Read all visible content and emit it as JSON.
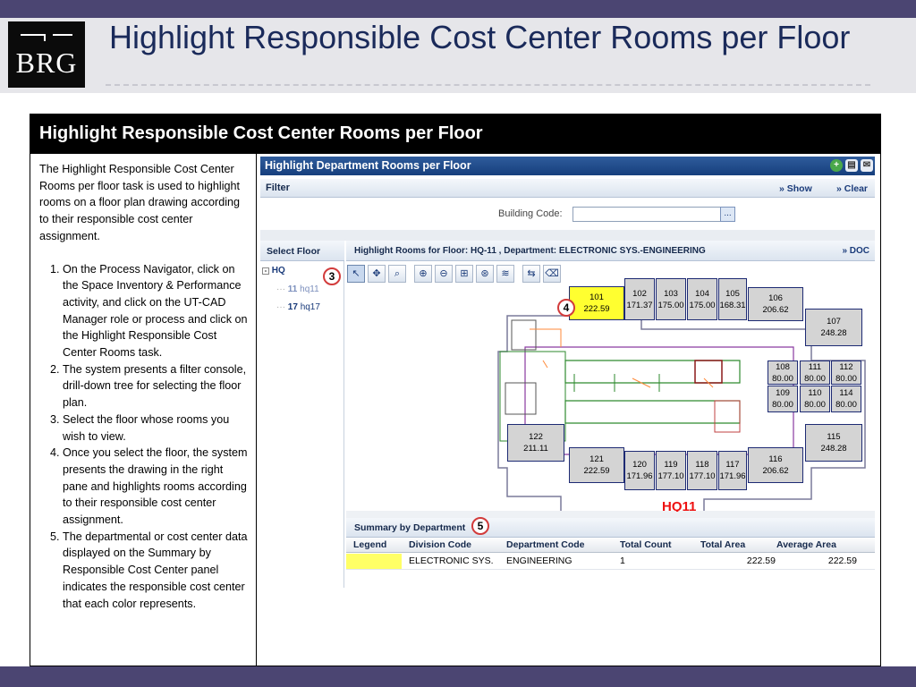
{
  "slide": {
    "title": "Highlight Responsible Cost Center Rooms per Floor",
    "logo_text": "BRG",
    "panel_heading": "Highlight Responsible Cost Center Rooms per Floor"
  },
  "description": {
    "intro": "The Highlight Responsible Cost Center Rooms per floor task is used to highlight rooms  on a floor plan drawing according to their responsible cost center assignment.",
    "steps": [
      "On the Process Navigator, click on the Space Inventory & Performance activity, and click on the UT-CAD Manager role or process and click on the Highlight Responsible Cost Center Rooms task.",
      "The system presents a filter console, drill-down tree for selecting the floor plan.",
      "Select the floor whose rooms you wish to view.",
      "Once you select the floor, the system presents the drawing in the right pane and highlights rooms according to their responsible cost center assignment.",
      "The departmental or cost center data displayed on the Summary by Responsible Cost Center panel indicates the responsible cost center that each color represents."
    ]
  },
  "app": {
    "title": "Highlight Department Rooms per Floor",
    "filter": {
      "label": "Filter",
      "show": "» Show",
      "clear": "» Clear",
      "building_code_label": "Building Code:",
      "building_code_value": "",
      "lookup": "..."
    },
    "select_floor": {
      "label": "Select Floor",
      "tree_root": "HQ",
      "floors": [
        {
          "code": "11",
          "name": "hq11"
        },
        {
          "code": "17",
          "name": "hq17"
        }
      ]
    },
    "drawing": {
      "header": "Highlight Rooms for Floor: HQ-11 , Department: ELECTRONIC SYS.-ENGINEERING",
      "doc_link": "» DOC",
      "floor_label": "HQ11",
      "rooms": [
        {
          "id": "101",
          "area": "222.59",
          "highlighted": true
        },
        {
          "id": "102",
          "area": "171.37"
        },
        {
          "id": "103",
          "area": "175.00"
        },
        {
          "id": "104",
          "area": "175.00"
        },
        {
          "id": "105",
          "area": "168.31"
        },
        {
          "id": "106",
          "area": "206.62"
        },
        {
          "id": "107",
          "area": "248.28"
        },
        {
          "id": "108",
          "area": "80.00"
        },
        {
          "id": "111",
          "area": "80.00"
        },
        {
          "id": "112",
          "area": "80.00"
        },
        {
          "id": "109",
          "area": "80.00"
        },
        {
          "id": "110",
          "area": "80.00"
        },
        {
          "id": "114",
          "area": "80.00"
        },
        {
          "id": "115",
          "area": "248.28"
        },
        {
          "id": "116",
          "area": "206.62"
        },
        {
          "id": "117",
          "area": "171.96"
        },
        {
          "id": "118",
          "area": "177.10"
        },
        {
          "id": "119",
          "area": "177.10"
        },
        {
          "id": "120",
          "area": "171.96"
        },
        {
          "id": "121",
          "area": "222.59"
        },
        {
          "id": "122",
          "area": "211.11"
        }
      ]
    },
    "summary": {
      "label": "Summary by Department",
      "columns": [
        "Legend",
        "Division Code",
        "Department Code",
        "Total Count",
        "Total Area",
        "Average Area"
      ],
      "rows": [
        {
          "legend_color": "#ffff66",
          "division": "ELECTRONIC SYS.",
          "department": "ENGINEERING",
          "count": "1",
          "total_area": "222.59",
          "avg_area": "222.59"
        }
      ]
    },
    "callouts": [
      "3",
      "4",
      "5"
    ]
  }
}
